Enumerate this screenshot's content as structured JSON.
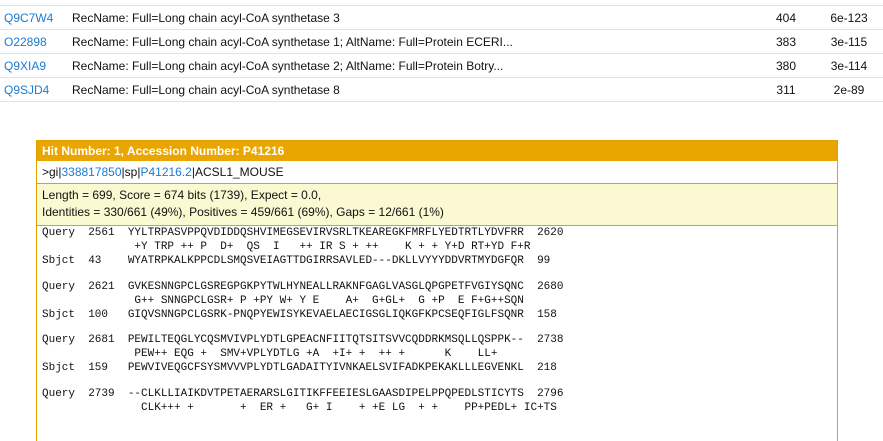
{
  "hits": [
    {
      "accession": "Q9C7W4",
      "description": "RecName: Full=Long chain acyl-CoA synthetase 3",
      "score": "404",
      "evalue": "6e-123"
    },
    {
      "accession": "O22898",
      "description": "RecName: Full=Long chain acyl-CoA synthetase 1; AltName: Full=Protein ECERI...",
      "score": "383",
      "evalue": "3e-115"
    },
    {
      "accession": "Q9XIA9",
      "description": "RecName: Full=Long chain acyl-CoA synthetase 2; AltName: Full=Protein Botry...",
      "score": "380",
      "evalue": "3e-114"
    },
    {
      "accession": "Q9SJD4",
      "description": "RecName: Full=Long chain acyl-CoA synthetase 8",
      "score": "311",
      "evalue": "2e-89"
    }
  ],
  "alignment": {
    "header": "Hit Number: 1, Accession Number: P41216",
    "defline": {
      "prefix": ">gi|",
      "gi_link": "338817850",
      "middle": "|sp|",
      "sp_link": "P41216.2",
      "suffix": "|ACSL1_MOUSE"
    },
    "stats_line1": "Length = 699, Score = 674 bits (1739), Expect = 0.0,",
    "stats_line2": "Identities = 330/661 (49%), Positives = 459/661 (69%), Gaps = 12/661 (1%)",
    "blocks": [
      {
        "query": "Query  2561  YYLTRPASVPPQVDIDDQSHVIMEGSEVIRVSRLTKEAREGKFMRFLYEDTRTLYDVFRR  2620",
        "match": "              +Y TRP ++ P  D+  QS  I   ++ IR S + ++    K + + Y+D RT+YD F+R",
        "sbjct": "Sbjct  43    WYATRPKALKPPCDLSMQSVEIAGTTDGIRRSAVLED---DKLLVYYYDDVRTMYDGFQR  99"
      },
      {
        "query": "Query  2621  GVKESNNGPCLGSREGPGKPYTWLHYNEALLRAKNFGAGLVASGLQPGPETFVGIYSQNC  2680",
        "match": "              G++ SNNGPCLGSR+ P +PY W+ Y E    A+  G+GL+  G +P  E F+G++SQN",
        "sbjct": "Sbjct  100   GIQVSNNGPCLGSRK-PNQPYEWISYKEVAELAECIGSGLIQKGFKPCSEQFIGLFSQNR  158"
      },
      {
        "query": "Query  2681  PEWILTEQGLYCQSMVIVPLYDTLGPEACNFIITQTSITSVVCQDDRKMSQLLQSPPK--  2738",
        "match": "              PEW++ EQG +  SMV+VPLYDTLG +A  +I+ +  ++ +      K    LL+",
        "sbjct": "Sbjct  159   PEWVIVEQGCFSYSMVVVPLYDTLGADAITYIVNKAELSVIFADKPEKAKLLLEGVENKL  218"
      },
      {
        "query": "Query  2739  --CLKLLIAIKDVTPETAERARSLGITIKFFEEIESLGAASDIPELPPQPEDLSTICYTS  2796",
        "match": "               CLK+++ +       +  ER +   G+ I    + +E LG  + +    PP+PEDL+ IC+TS"
      }
    ]
  }
}
